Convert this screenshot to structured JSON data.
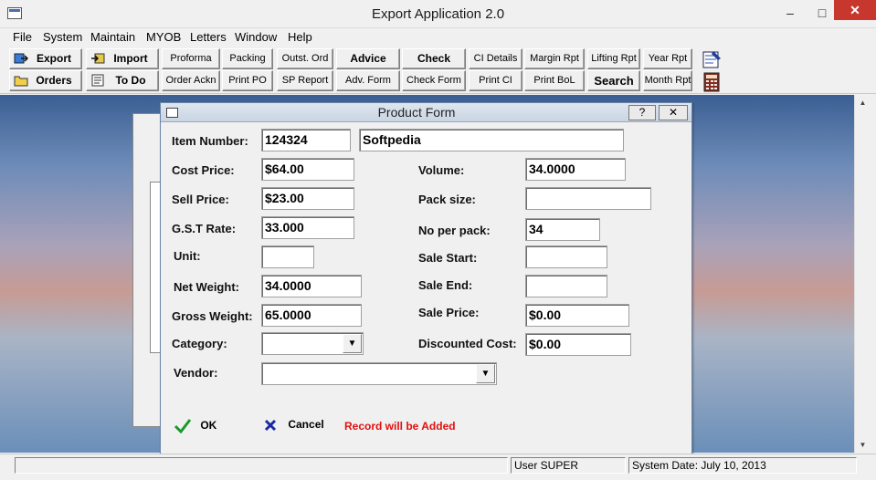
{
  "window": {
    "title": "Export  Application  2.0",
    "min": "–",
    "max": "□",
    "close": "✕"
  },
  "menu": [
    "File",
    "System",
    "Maintain",
    "MYOB",
    "Letters",
    "Window",
    "Help"
  ],
  "toolbar": {
    "export": "Export",
    "import": "Import",
    "orders": "Orders",
    "todo": "To Do",
    "proforma": "Proforma",
    "packing": "Packing",
    "outst_ord": "Outst. Ord",
    "advice": "Advice",
    "check": "Check",
    "ci_details": "CI Details",
    "margin_rpt": "Margin Rpt",
    "lifting_rpt": "Lifting Rpt",
    "year_rpt": "Year Rpt",
    "order_ackn": "Order Ackn",
    "print_po": "Print PO",
    "sp_report": "SP Report",
    "adv_form": "Adv. Form",
    "check_form": "Check Form",
    "print_ci": "Print CI",
    "print_bol": "Print BoL",
    "search": "Search",
    "month_rpt": "Month Rpt"
  },
  "form": {
    "title": "Product Form",
    "help": "?",
    "close": "✕",
    "labels": {
      "item_number": "Item Number:",
      "cost_price": "Cost Price:",
      "sell_price": "Sell Price:",
      "gst_rate": "G.S.T Rate:",
      "unit": "Unit:",
      "net_weight": "Net Weight:",
      "gross_weight": "Gross Weight:",
      "category": "Category:",
      "vendor": "Vendor:",
      "volume": "Volume:",
      "pack_size": "Pack size:",
      "no_per_pack": "No per pack:",
      "sale_start": "Sale Start:",
      "sale_end": "Sale End:",
      "sale_price": "Sale Price:",
      "discounted_cost": "Discounted Cost:"
    },
    "values": {
      "item_number": "124324",
      "item_name": "Softpedia",
      "cost_price": "$64.00",
      "sell_price": "$23.00",
      "gst_rate": "33.000",
      "unit": "",
      "net_weight": "34.0000",
      "gross_weight": "65.0000",
      "category": "",
      "vendor": "",
      "volume": "34.0000",
      "pack_size": "",
      "no_per_pack": "34",
      "sale_start": "",
      "sale_end": "",
      "sale_price": "$0.00",
      "discounted_cost": "$0.00"
    },
    "ok": "OK",
    "cancel": "Cancel",
    "status_msg": "Record will be Added",
    "status_color": "#e01010"
  },
  "status": {
    "user": "User SUPER",
    "date": "System Date: July 10, 2013"
  }
}
